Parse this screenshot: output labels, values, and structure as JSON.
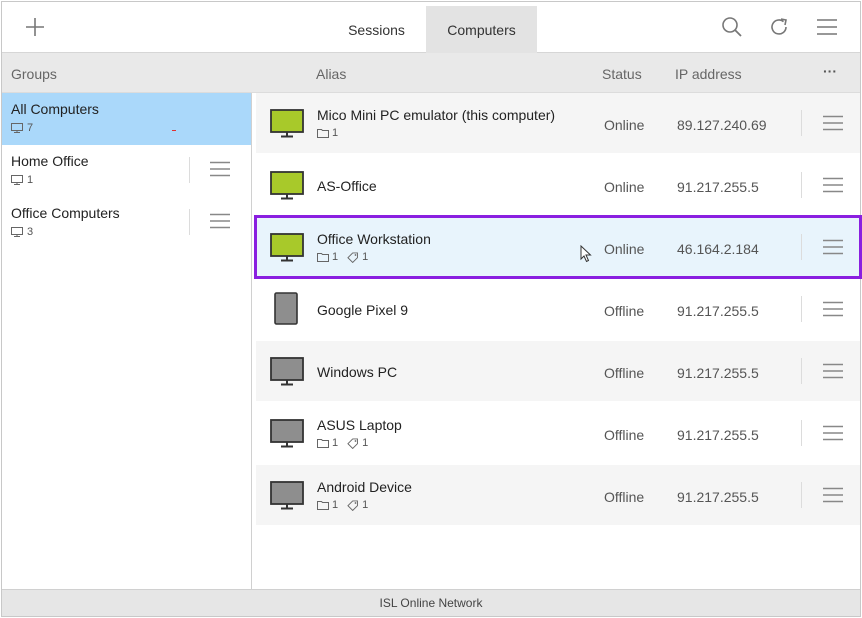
{
  "tabs": [
    {
      "label": "Sessions",
      "active": false
    },
    {
      "label": "Computers",
      "active": true
    }
  ],
  "toolbar": {
    "icons": [
      "plus-icon",
      "search-icon",
      "refresh-icon",
      "menu-icon"
    ]
  },
  "header": {
    "groups": "Groups",
    "alias": "Alias",
    "status": "Status",
    "ip": "IP address",
    "more": "···"
  },
  "groups": [
    {
      "name": "All Computers",
      "count": "7",
      "selected": true
    },
    {
      "name": "Home Office",
      "count": "1",
      "selected": false
    },
    {
      "name": "Office Computers",
      "count": "3",
      "selected": false
    }
  ],
  "computers": [
    {
      "alias": "Mico Mini PC emulator (this computer)",
      "folders": "1",
      "tags": "",
      "status": "Online",
      "ip": "89.127.240.69",
      "device": "monitor",
      "online": true
    },
    {
      "alias": "AS-Office",
      "folders": "",
      "tags": "",
      "status": "Online",
      "ip": "91.217.255.5",
      "device": "monitor",
      "online": true
    },
    {
      "alias": "Office Workstation",
      "folders": "1",
      "tags": "1",
      "status": "Online",
      "ip": "46.164.2.184",
      "device": "monitor",
      "online": true
    },
    {
      "alias": "Google Pixel 9",
      "folders": "",
      "tags": "",
      "status": "Offline",
      "ip": "91.217.255.5",
      "device": "phone",
      "online": false
    },
    {
      "alias": "Windows PC",
      "folders": "",
      "tags": "",
      "status": "Offline",
      "ip": "91.217.255.5",
      "device": "monitor",
      "online": false
    },
    {
      "alias": "ASUS Laptop",
      "folders": "1",
      "tags": "1",
      "status": "Offline",
      "ip": "91.217.255.5",
      "device": "monitor",
      "online": false
    },
    {
      "alias": "Android Device",
      "folders": "1",
      "tags": "1",
      "status": "Offline",
      "ip": "91.217.255.5",
      "device": "monitor",
      "online": false
    }
  ],
  "footer": {
    "text": "ISL Online Network"
  },
  "colors": {
    "online_screen": "#a8c92a",
    "offline_screen": "#8e8e8e",
    "selected_group": "#aad8fa",
    "highlight_border": "#8a1fe0"
  }
}
